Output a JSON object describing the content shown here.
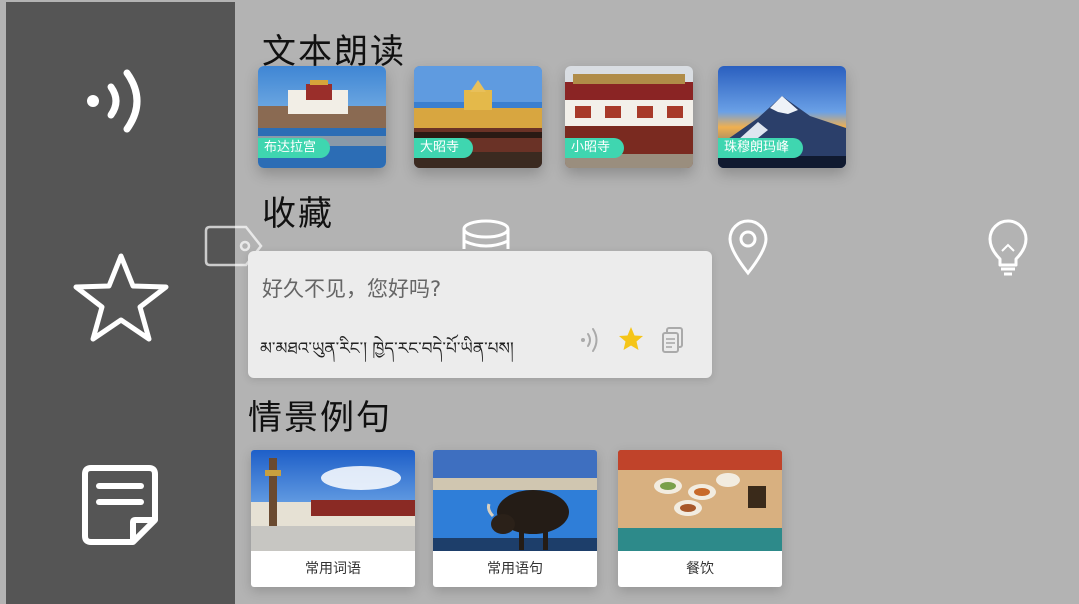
{
  "sidebar": {
    "items": [
      {
        "icon": "speaker-wave-icon"
      },
      {
        "icon": "star-outline-icon"
      },
      {
        "icon": "note-icon"
      }
    ]
  },
  "sections": {
    "tts_title": "文本朗读",
    "favorites_title": "收藏",
    "scenes_title": "情景例句"
  },
  "tts_cards": [
    {
      "label": "布达拉宫"
    },
    {
      "label": "大昭寺"
    },
    {
      "label": "小昭寺"
    },
    {
      "label": "珠穆朗玛峰"
    }
  ],
  "favorite_category_icons": [
    "tag-icon",
    "database-icon",
    "location-pin-icon",
    "lightbulb-icon"
  ],
  "favorite_card": {
    "chinese": "好久不见，您好吗?",
    "tibetan": "མ་མཐའ་ཡུན་རིང་། ཁྱེད་རང་བདེ་པོ་ཡིན་པས།",
    "actions": [
      "speaker-icon",
      "star-filled-icon",
      "copy-icon"
    ],
    "star_color": "#f5c518"
  },
  "scene_cards": [
    {
      "label": "常用词语"
    },
    {
      "label": "常用语句"
    },
    {
      "label": "餐饮"
    }
  ],
  "colors": {
    "background": "#b3b3b3",
    "sidebar": "#555555",
    "tag": "#3fd6b0"
  }
}
